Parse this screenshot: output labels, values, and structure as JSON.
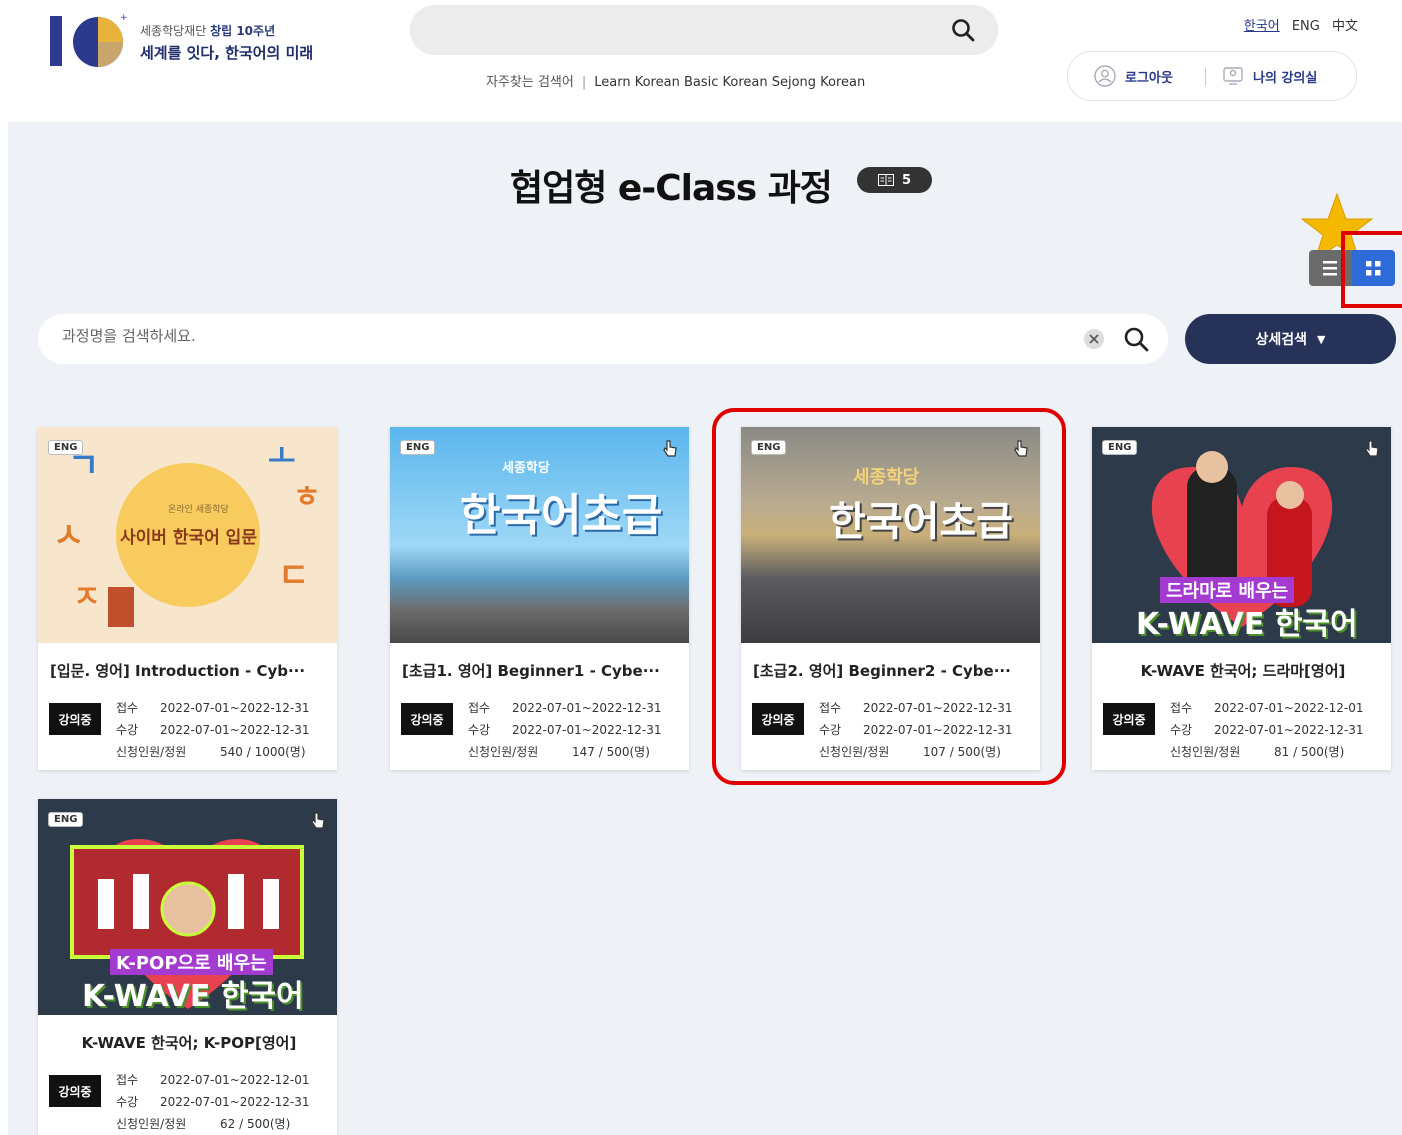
{
  "header": {
    "logo_sub_prefix": "세종학당재단",
    "logo_sub_bold": "창립 10주년",
    "logo_main": "세계를 잇다, 한국어의 미래",
    "frequent_label": "자주찾는 검색어",
    "frequent_terms": "Learn Korean Basic Korean Sejong Korean",
    "languages": [
      "한국어",
      "ENG",
      "中文"
    ],
    "logout_label": "로그아웃",
    "my_classroom_label": "나의 강의실"
  },
  "page": {
    "title": "협업형 e-Class 과정",
    "count": "5",
    "search_placeholder": "과정명을 검색하세요.",
    "detail_search_label": "상세검색"
  },
  "courses": [
    {
      "badge": "ENG",
      "thumb_text": "사이버 한국어 입문",
      "title": "[입문. 영어] Introduction - Cyb···",
      "status": "강의중",
      "apply_label": "접수",
      "apply_period": "2022-07-01~2022-12-31",
      "study_label": "수강",
      "study_period": "2022-07-01~2022-12-31",
      "capacity_label": "신청인원/정원",
      "capacity": "540 / 1000(명)"
    },
    {
      "badge": "ENG",
      "thumb_text": "한국어초급",
      "title": "[초급1. 영어] Beginner1 - Cybe···",
      "status": "강의중",
      "apply_label": "접수",
      "apply_period": "2022-07-01~2022-12-31",
      "study_label": "수강",
      "study_period": "2022-07-01~2022-12-31",
      "capacity_label": "신청인원/정원",
      "capacity": "147 / 500(명)"
    },
    {
      "badge": "ENG",
      "thumb_text": "한국어초급",
      "title": "[초급2. 영어] Beginner2 - Cybe···",
      "status": "강의중",
      "apply_label": "접수",
      "apply_period": "2022-07-01~2022-12-31",
      "study_label": "수강",
      "study_period": "2022-07-01~2022-12-31",
      "capacity_label": "신청인원/정원",
      "capacity": "107 / 500(명)"
    },
    {
      "badge": "ENG",
      "thumb_text": "K-WAVE 한국어",
      "title": "K-WAVE 한국어; 드라마[영어]",
      "status": "강의중",
      "apply_label": "접수",
      "apply_period": "2022-07-01~2022-12-01",
      "study_label": "수강",
      "study_period": "2022-07-01~2022-12-31",
      "capacity_label": "신청인원/정원",
      "capacity": "81 / 500(명)"
    },
    {
      "badge": "ENG",
      "thumb_text": "K-WAVE 한국어",
      "title": "K-WAVE 한국어; K-POP[영어]",
      "status": "강의중",
      "apply_label": "접수",
      "apply_period": "2022-07-01~2022-12-01",
      "study_label": "수강",
      "study_period": "2022-07-01~2022-12-31",
      "capacity_label": "신청인원/정원",
      "capacity": "62 / 500(명)"
    }
  ],
  "colors": {
    "navy": "#263258",
    "accent_blue": "#2f6bd8",
    "highlight_red": "#e00000",
    "star_gold": "#f5b800",
    "content_bg": "#eef1f5"
  }
}
